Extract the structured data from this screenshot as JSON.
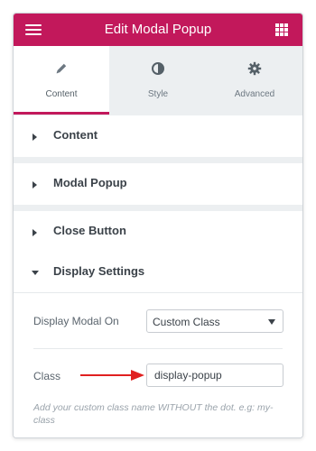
{
  "header": {
    "title": "Edit Modal Popup",
    "menu_icon": "hamburger-menu-icon",
    "grid_icon": "apps-grid-icon",
    "brand_color": "#c2185b"
  },
  "tabs": [
    {
      "label": "Content",
      "icon": "pencil-icon",
      "active": true
    },
    {
      "label": "Style",
      "icon": "half-circle-contrast-icon",
      "active": false
    },
    {
      "label": "Advanced",
      "icon": "gear-icon",
      "active": false
    }
  ],
  "sections": [
    {
      "title": "Content",
      "expanded": false
    },
    {
      "title": "Modal Popup",
      "expanded": false
    },
    {
      "title": "Close Button",
      "expanded": false
    },
    {
      "title": "Display Settings",
      "expanded": true
    }
  ],
  "display_settings": {
    "display_on_label": "Display Modal On",
    "display_on_value": "Custom Class",
    "class_label": "Class",
    "class_value": "display-popup",
    "hint": "Add your custom class name WITHOUT the dot. e.g: my-class",
    "annotation_color": "#e02020"
  }
}
